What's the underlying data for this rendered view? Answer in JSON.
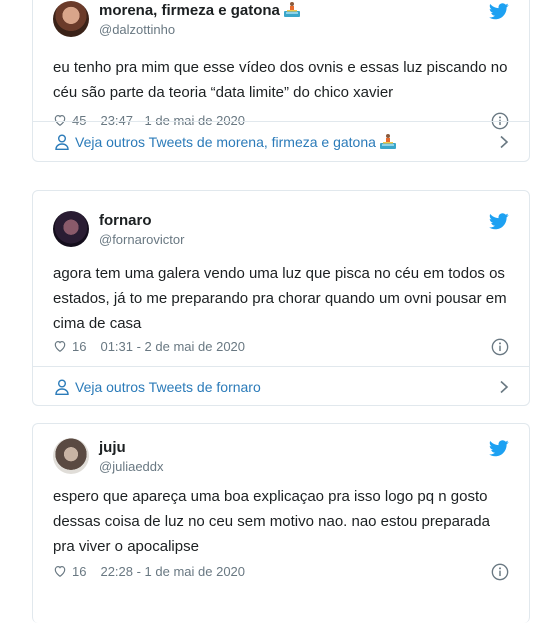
{
  "tweets": [
    {
      "name": "morena, firmeza e gatona",
      "handle": "@dalzottinho",
      "text": "eu tenho pra mim que esse vídeo dos ovnis e essas luz piscando no céu são parte da teoria “data limite” do chico xavier",
      "likes": "45",
      "timestamp": "23:47 - 1 de mai de 2020",
      "more_link": "Veja outros Tweets de morena, firmeza e gatona"
    },
    {
      "name": "fornaro",
      "handle": "@fornarovictor",
      "text": "agora tem uma galera vendo uma luz que pisca no céu em todos os estados, já to me preparando pra chorar quando um ovni pousar em cima de casa",
      "likes": "16",
      "timestamp": "01:31 - 2 de mai de 2020",
      "more_link": "Veja outros Tweets de fornaro"
    },
    {
      "name": "juju",
      "handle": "@juliaeddx",
      "text": "espero que apareça uma boa explicaçao pra isso logo pq n gosto dessas coisa de luz no ceu sem motivo nao. nao estou preparada pra viver o apocalipse",
      "likes": "16",
      "timestamp": "22:28 - 1 de mai de 2020"
    }
  ],
  "colors": {
    "link": "#2b7bb9",
    "twitter_blue": "#1da1f2",
    "muted": "#697882",
    "border": "#e1e8ed"
  },
  "icons": {
    "brand": "twitter-bird-icon",
    "like": "heart-icon",
    "info": "info-icon",
    "profile": "person-icon",
    "next": "chevron-right-icon",
    "emoji": "surfer-emoji-icon"
  }
}
